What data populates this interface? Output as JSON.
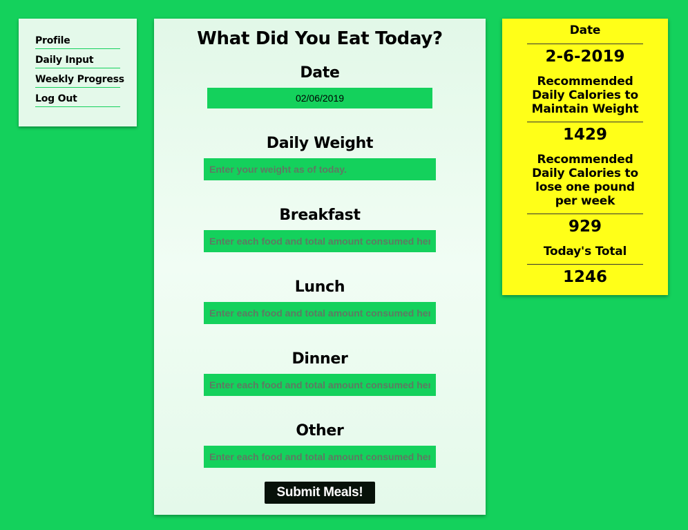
{
  "nav": {
    "items": [
      {
        "label": "Profile"
      },
      {
        "label": "Daily Input"
      },
      {
        "label": "Weekly Progress"
      },
      {
        "label": "Log Out"
      }
    ]
  },
  "form": {
    "title": "What Did You Eat Today?",
    "date_label": "Date",
    "date_value": "02/06/2019",
    "weight_label": "Daily Weight",
    "weight_placeholder": "Enter your weight as of today.",
    "breakfast_label": "Breakfast",
    "breakfast_placeholder": "Enter each food and total amount consumed here",
    "lunch_label": "Lunch",
    "lunch_placeholder": "Enter each food and total amount consumed here",
    "dinner_label": "Dinner",
    "dinner_placeholder": "Enter each food and total amount consumed here",
    "other_label": "Other",
    "other_placeholder": "Enter each food and total amount consumed here",
    "submit_label": "Submit Meals!"
  },
  "summary": {
    "date_heading": "Date",
    "date_value": "2-6-2019",
    "maintain_heading": "Recommended Daily Calories to Maintain Weight",
    "maintain_value": "1429",
    "lose_heading": "Recommended Daily Calories to lose one pound per week",
    "lose_value": "929",
    "total_heading": "Today's Total",
    "total_value": "1246"
  },
  "colors": {
    "background": "#14d15c",
    "summary_card": "#ffff18",
    "submit_button": "#071109"
  }
}
